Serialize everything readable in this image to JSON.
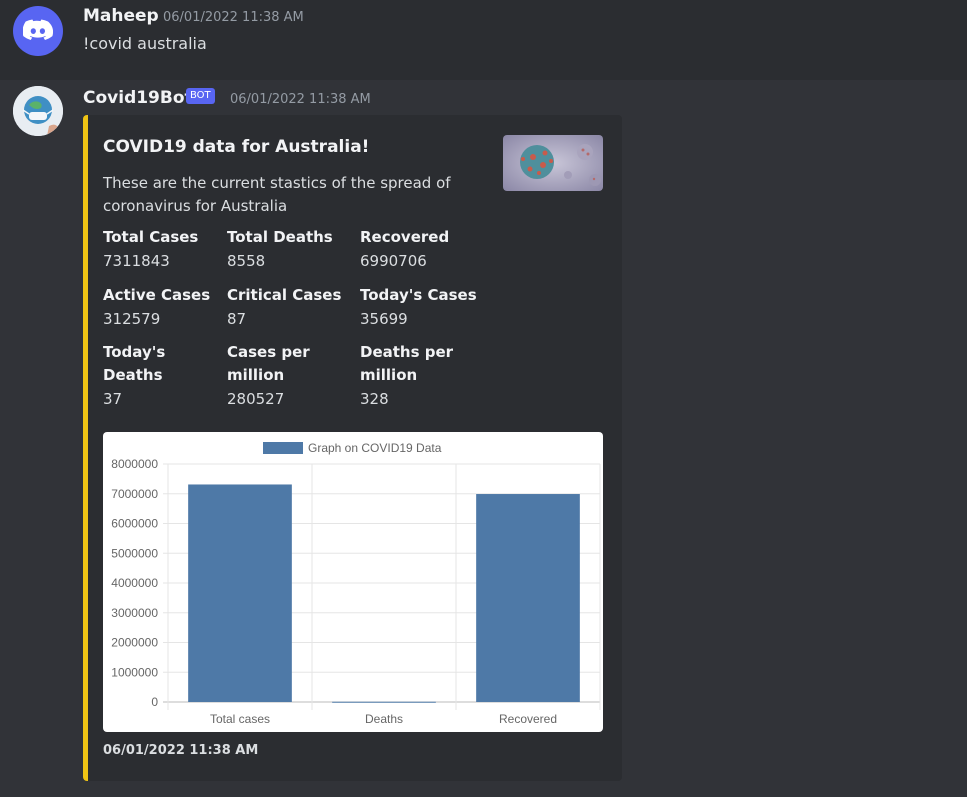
{
  "messages": [
    {
      "username": "Maheep",
      "timestamp": "06/01/2022 11:38 AM",
      "content": "!covid australia"
    },
    {
      "username": "Covid19Bot",
      "bot_tag": "BOT",
      "timestamp": "06/01/2022 11:38 AM",
      "embed": {
        "accent_color": "#f0c414",
        "title": "COVID19 data for Australia!",
        "description": "These are the current stastics of the spread of coronavirus for Australia",
        "fields": [
          {
            "name": "Total Cases",
            "value": "7311843"
          },
          {
            "name": "Total Deaths",
            "value": "8558"
          },
          {
            "name": "Recovered",
            "value": "6990706"
          },
          {
            "name": "Active Cases",
            "value": "312579"
          },
          {
            "name": "Critical Cases",
            "value": "87"
          },
          {
            "name": "Today's Cases",
            "value": "35699"
          },
          {
            "name": "Today's Deaths",
            "value": "37"
          },
          {
            "name": "Cases per million",
            "value": "280527"
          },
          {
            "name": "Deaths per million",
            "value": "328"
          }
        ],
        "footer": "06/01/2022 11:38 AM"
      }
    }
  ],
  "chart_data": {
    "type": "bar",
    "categories": [
      "Total cases",
      "Deaths",
      "Recovered"
    ],
    "series": [
      {
        "name": "Graph on COVID19 Data",
        "values": [
          7311843,
          8558,
          6990706
        ],
        "color": "#4e79a7"
      }
    ],
    "ylim": [
      0,
      8000000
    ],
    "yticks": [
      "0",
      "1000000",
      "2000000",
      "3000000",
      "4000000",
      "5000000",
      "6000000",
      "7000000",
      "8000000"
    ],
    "legend": "top",
    "grid": true
  },
  "icons": {
    "discord_avatar": "discord-logo-icon",
    "bot_avatar": "globe-mask-icon",
    "thumbnail": "coronavirus-image"
  }
}
